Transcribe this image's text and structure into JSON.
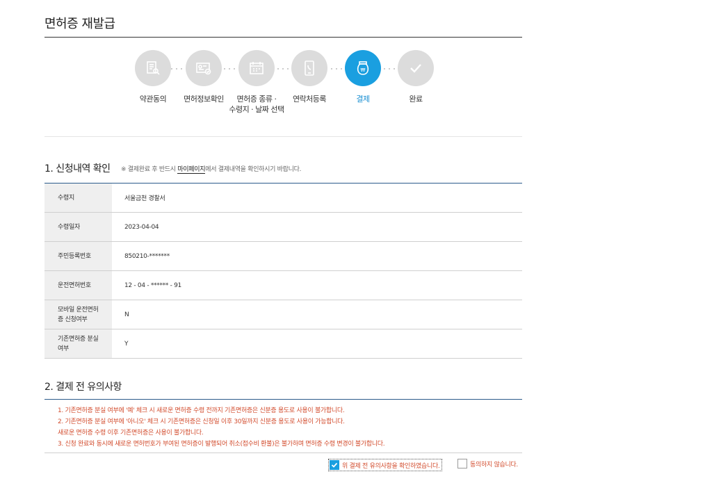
{
  "page_title": "면허증 재발급",
  "steps": [
    {
      "label": "약관동의",
      "icon": "document-search-icon",
      "active": false
    },
    {
      "label": "면허정보확인",
      "icon": "id-card-check-icon",
      "active": false
    },
    {
      "label_line1": "면허증 종류 ·",
      "label_line2": "수령지 · 날짜 선택",
      "icon": "calendar-icon",
      "active": false
    },
    {
      "label": "연락처등록",
      "icon": "phone-icon",
      "active": false
    },
    {
      "label": "결제",
      "icon": "won-bag-icon",
      "active": true
    },
    {
      "label": "완료",
      "icon": "check-icon",
      "active": false
    }
  ],
  "section1": {
    "title": "1. 신청내역 확인",
    "note_prefix": "※ 결제완료 후 반드시 ",
    "note_link": "마이페이지",
    "note_suffix": "에서 결제내역을 확인하시기 바랍니다.",
    "rows": [
      {
        "label": "수령지",
        "value": "서울금천 경찰서"
      },
      {
        "label": "수령일자",
        "value": "2023-04-04"
      },
      {
        "label": "주민등록번호",
        "value": "850210-*******"
      },
      {
        "label": "운전면허번호",
        "value": "12 - 04 - ****** - 91"
      },
      {
        "label_line1": "모바일 운전면허",
        "label_line2": "증 신청여부",
        "value": "N"
      },
      {
        "label_line1": "기존면허증 분실",
        "label_line2": "여부",
        "value": "Y"
      }
    ]
  },
  "section2": {
    "title": "2. 결제 전 유의사항",
    "notices": [
      {
        "text": "1. 기존면허증 분실 여부에 '예' 체크 시 새로운 면허증 수령 전까지 기존면허증은 신분증 용도로 사용이 불가합니다.",
        "color": "red"
      },
      {
        "text": "2. 기존면허증 분실 여부에 '아니오' 체크 시 기존면허증은 신청일 이후 30일까지 신분증 용도로 사용이 가능합니다.",
        "color": "red"
      },
      {
        "text": "새로운 면허증 수령 이후 기존면허증은 사용이 불가합니다.",
        "color": "red"
      },
      {
        "text": "3. 신청 완료와 동시에 새로운 면허번호가 부여된 면허증이 발행되어 취소(접수비 환불)은 불가하며 면허증 수령 변경이 불가합니다.",
        "color": "red"
      }
    ],
    "agree_label": "위 결제 전 유의사항을 확인하였습니다.",
    "agree_checked": true,
    "disagree_label": "동의하지 않습니다.",
    "disagree_checked": false
  },
  "colors": {
    "accent": "#1a9fe0",
    "step_inactive": "#dcdcdc",
    "notice_red": "#d24a2b",
    "table_header_bg": "#efefef",
    "rule_blue": "#2a5a8a"
  }
}
